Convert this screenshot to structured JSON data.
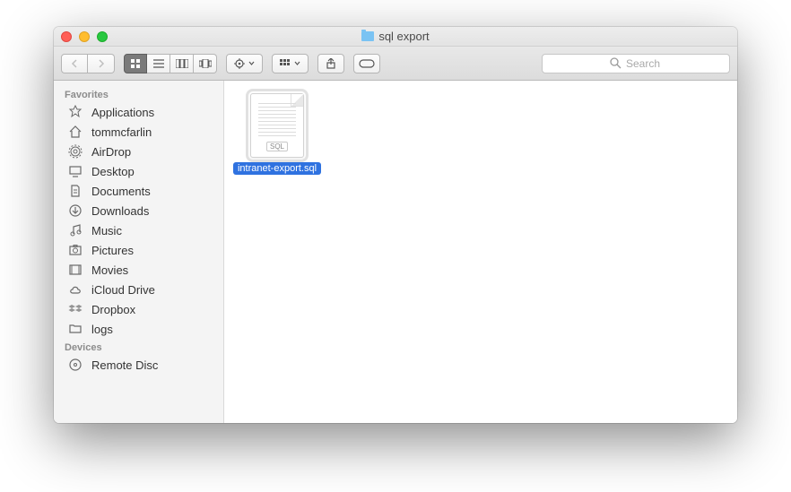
{
  "window": {
    "title": "sql export"
  },
  "toolbar": {
    "search_placeholder": "Search"
  },
  "sidebar": {
    "sections": [
      {
        "header": "Favorites",
        "items": [
          {
            "icon": "applications",
            "label": "Applications"
          },
          {
            "icon": "home",
            "label": "tommcfarlin"
          },
          {
            "icon": "airdrop",
            "label": "AirDrop"
          },
          {
            "icon": "desktop",
            "label": "Desktop"
          },
          {
            "icon": "documents",
            "label": "Documents"
          },
          {
            "icon": "downloads",
            "label": "Downloads"
          },
          {
            "icon": "music",
            "label": "Music"
          },
          {
            "icon": "pictures",
            "label": "Pictures"
          },
          {
            "icon": "movies",
            "label": "Movies"
          },
          {
            "icon": "icloud",
            "label": "iCloud Drive"
          },
          {
            "icon": "dropbox",
            "label": "Dropbox"
          },
          {
            "icon": "folder",
            "label": "logs"
          }
        ]
      },
      {
        "header": "Devices",
        "items": [
          {
            "icon": "disc",
            "label": "Remote Disc"
          }
        ]
      }
    ]
  },
  "files": [
    {
      "name": "intranet-export.sql",
      "badge": "SQL",
      "selected": true
    }
  ]
}
